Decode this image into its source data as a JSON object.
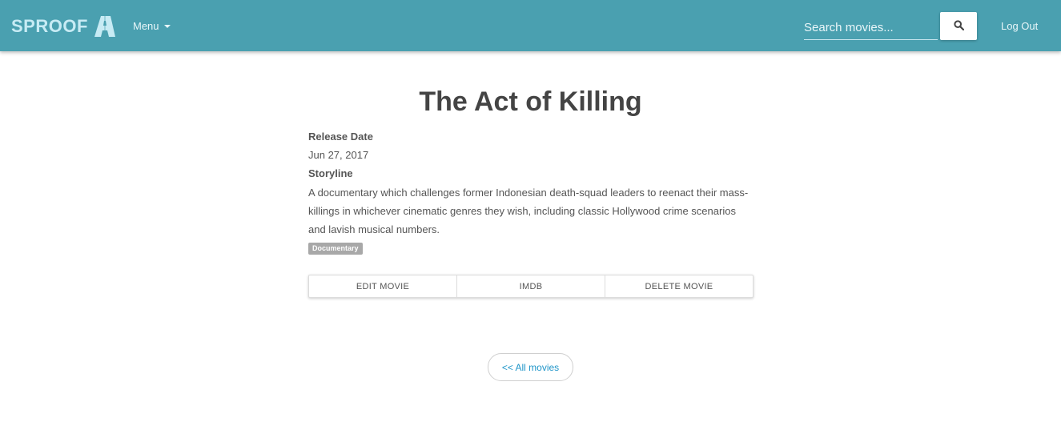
{
  "navbar": {
    "brand": "SPROOF",
    "menu_label": "Menu",
    "search_placeholder": "Search movies...",
    "logout_label": "Log Out"
  },
  "movie": {
    "title": "The Act of Killing",
    "release_date_label": "Release Date",
    "release_date": "Jun 27, 2017",
    "storyline_label": "Storyline",
    "storyline": "A documentary which challenges former Indonesian death-squad leaders to reenact their mass-killings in whichever cinematic genres they wish, including classic Hollywood crime scenarios and lavish musical numbers.",
    "genre": "Documentary"
  },
  "actions": {
    "edit_label": "EDIT MOVIE",
    "imdb_label": "IMDB",
    "delete_label": "DELETE MOVIE"
  },
  "back_link": "<< All movies",
  "icons": {
    "logo": "brand-logo-icon",
    "menu_caret": "caret-down-icon",
    "search": "search-icon"
  },
  "colors": {
    "navbar": "#4aa0b0",
    "link": "#2196c9",
    "badge": "#a8a8a8"
  }
}
